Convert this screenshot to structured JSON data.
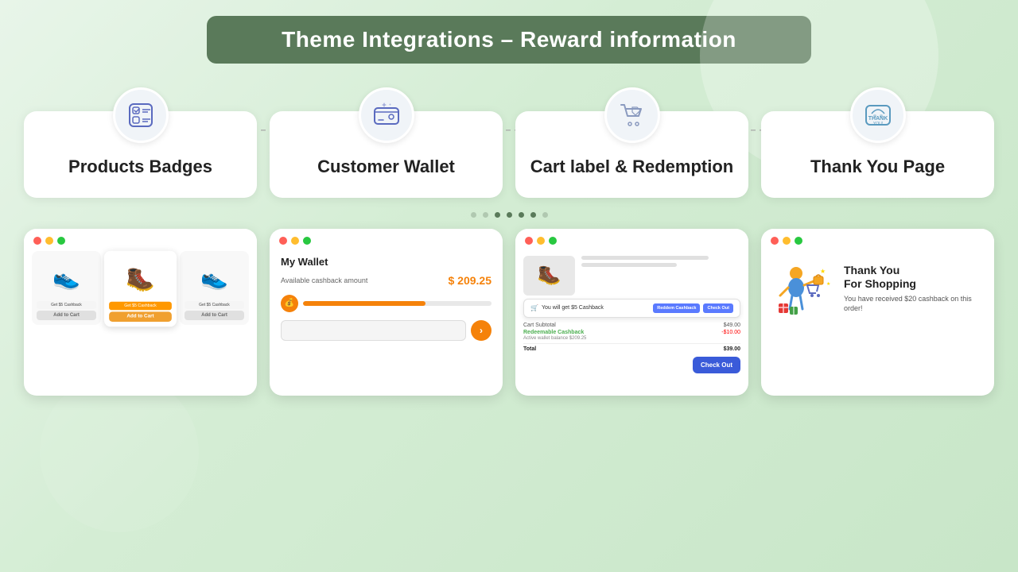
{
  "page": {
    "title": "Theme Integrations - Reward information",
    "background_color": "#d4edd4"
  },
  "header": {
    "title": "Theme Integrations – Reward information"
  },
  "cards": [
    {
      "id": "products-badges",
      "title": "Products Badges",
      "icon": "badge-icon"
    },
    {
      "id": "customer-wallet",
      "title": "Customer Wallet",
      "icon": "wallet-icon"
    },
    {
      "id": "cart-redemption",
      "title": "Cart label & Redemption",
      "icon": "cart-icon"
    },
    {
      "id": "thank-you-page",
      "title": "Thank You Page",
      "icon": "thank-you-icon"
    }
  ],
  "dots": [
    "d1",
    "d2",
    "d3",
    "d4",
    "d5",
    "d6",
    "d7"
  ],
  "screenshots": {
    "wallet": {
      "title": "My Wallet",
      "label": "Available cashback amount",
      "amount": "$ 209.25"
    },
    "cart": {
      "cashback_line": "You will get $5 Cashback",
      "redeem_btn": "Reddem Cashback",
      "checkout_btn": "Check Out",
      "subtotal_label": "Cart Subtotal",
      "subtotal_value": "$49.00",
      "cashback_label": "Redeemable Cashback",
      "cashback_note": "Active wallet balance $209.25",
      "cashback_value": "-$10.00",
      "total_label": "Total",
      "total_value": "$39.00",
      "checkout_big": "Check Out"
    },
    "thankyou": {
      "heading_line1": "Thank You",
      "heading_line2": "For Shopping",
      "body": "You have received $20 cashback on this order!"
    },
    "products": {
      "badge1": "Get $5 Cashback",
      "badge2": "Get $5 Cashback",
      "badge3": "Get $5 Cashback",
      "btn_featured": "Add to Cart",
      "btn_normal": "Add to Cart"
    }
  },
  "window_buttons": {
    "red": "#ff5f57",
    "yellow": "#ffbd2e",
    "green": "#28c840"
  }
}
